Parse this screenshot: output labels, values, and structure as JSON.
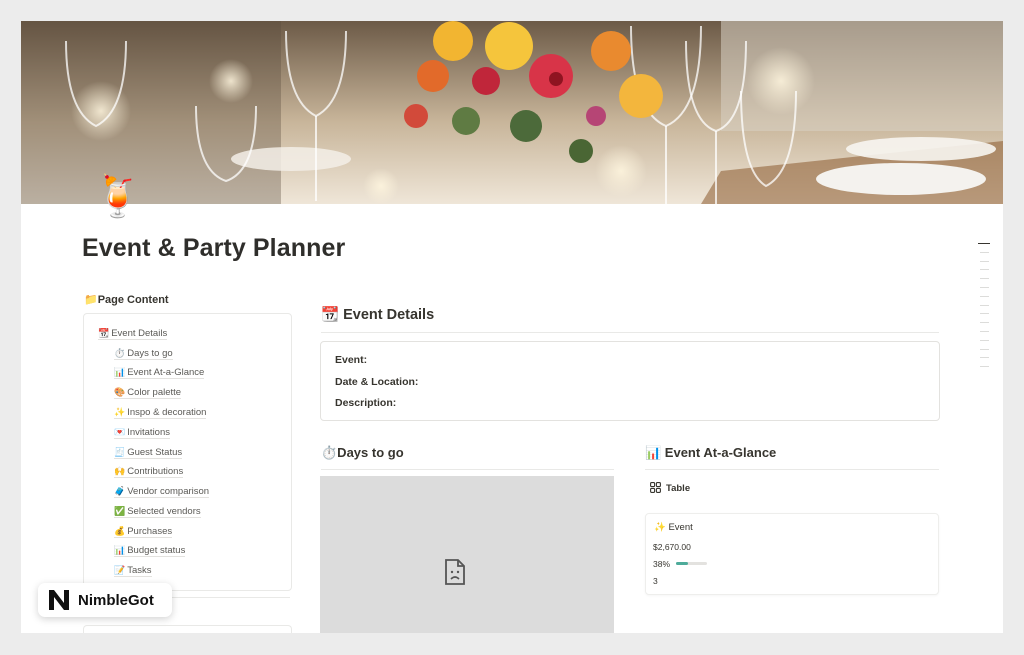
{
  "page": {
    "icon": "🍹",
    "title": "Event & Party Planner"
  },
  "toc": {
    "heading": "📁Page Content",
    "items": [
      {
        "icon": "📆",
        "label": "Event Details"
      },
      {
        "icon": "⏱️",
        "label": "Days to go"
      },
      {
        "icon": "📊",
        "label": "Event At-a-Glance"
      },
      {
        "icon": "🎨",
        "label": "Color palette"
      },
      {
        "icon": "✨",
        "label": "Inspo & decoration"
      },
      {
        "icon": "💌",
        "label": "Invitations"
      },
      {
        "icon": "🧾",
        "label": "Guest Status"
      },
      {
        "icon": "🙌",
        "label": "Contributions"
      },
      {
        "icon": "🧳",
        "label": "Vendor comparison"
      },
      {
        "icon": "✅",
        "label": "Selected vendors"
      },
      {
        "icon": "💰",
        "label": "Purchases"
      },
      {
        "icon": "📊",
        "label": "Budget status"
      },
      {
        "icon": "📝",
        "label": "Tasks"
      }
    ]
  },
  "event_details": {
    "heading": "📆 Event Details",
    "fields": [
      "Event:",
      "Date & Location:",
      "Description:"
    ]
  },
  "days_to_go": {
    "heading": "⏱️Days to go",
    "embed_icon": "broken-image-icon"
  },
  "glance": {
    "heading": "📊 Event At-a-Glance",
    "view_label": "Table",
    "view_icon": "gallery-grid-icon",
    "card": {
      "title": "✨ Event",
      "amount": "$2,670.00",
      "progress_label": "38%",
      "progress": 0.38,
      "count": "3"
    }
  },
  "badge": {
    "logo_letter": "N",
    "text": "NimbleGot"
  },
  "colors": {
    "accent": "#4dab9a",
    "text": "#37352f",
    "border": "#e9e9e7"
  }
}
